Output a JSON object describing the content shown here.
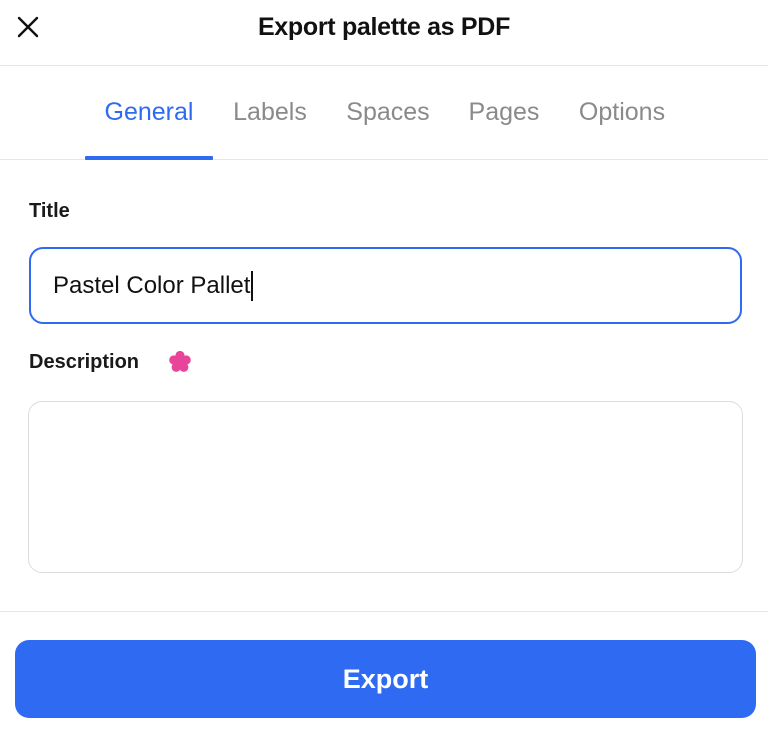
{
  "header": {
    "title": "Export palette as PDF",
    "close_icon": "close-icon"
  },
  "tabs": [
    {
      "label": "General",
      "active": true
    },
    {
      "label": "Labels",
      "active": false
    },
    {
      "label": "Spaces",
      "active": false
    },
    {
      "label": "Pages",
      "active": false
    },
    {
      "label": "Options",
      "active": false
    }
  ],
  "form": {
    "title_label": "Title",
    "title_value": "Pastel Color Pallet",
    "description_label": "Description",
    "description_icon": "flower-icon",
    "description_value": ""
  },
  "footer": {
    "export_label": "Export"
  },
  "colors": {
    "accent": "#2f6bf2",
    "flower": "#e8449a",
    "inactive_tab": "#8a8a8a"
  }
}
